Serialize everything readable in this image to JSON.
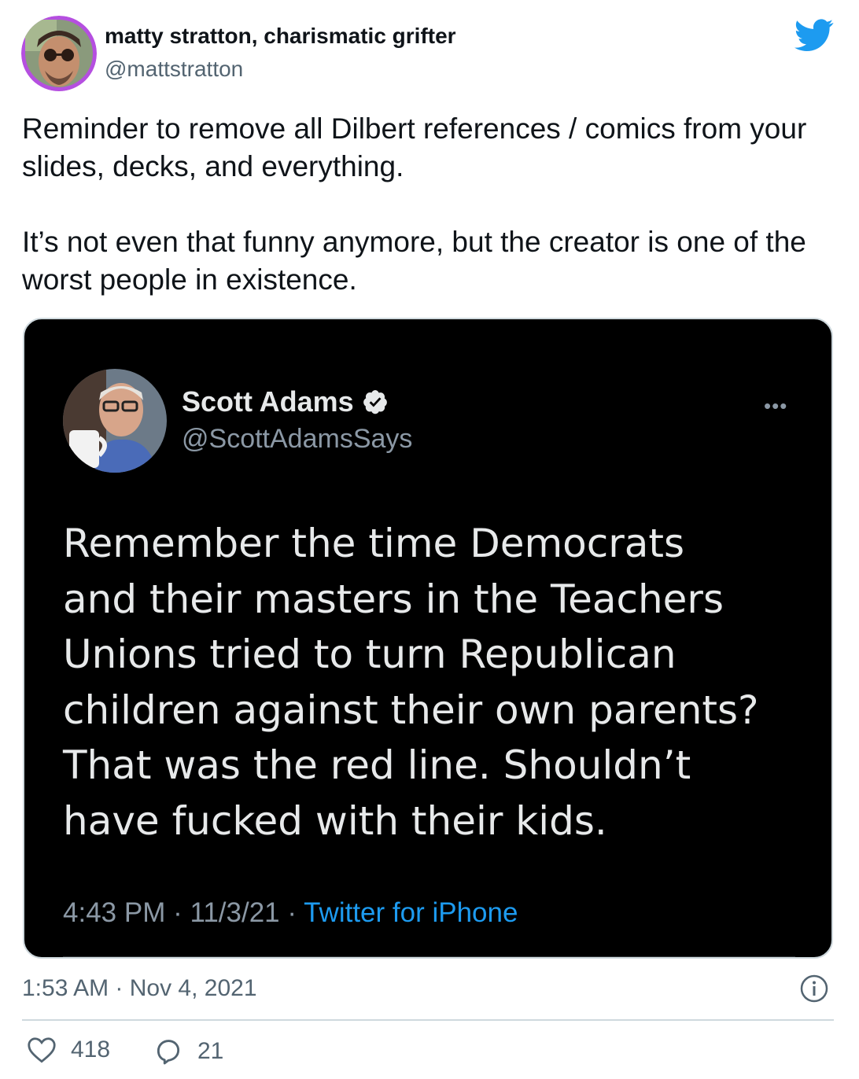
{
  "author": {
    "display_name": "matty stratton, charismatic grifter",
    "handle": "@mattstratton"
  },
  "tweet": {
    "paragraphs": [
      "Reminder to remove all Dilbert references / comics from your slides, decks, and everything.",
      "It’s not even that funny anymore, but the creator is one of the worst people in existence."
    ],
    "timestamp": "1:53 AM · Nov 4, 2021",
    "likes": "418",
    "replies": "21"
  },
  "quoted": {
    "display_name": "Scott Adams",
    "handle": "@ScottAdamsSays",
    "text": "Remember the time Democrats and their masters in the Teachers Unions tried to turn Republican children against their own parents? That was the red line. Shouldn’t have fucked with their kids.",
    "time": "4:43 PM · 11/3/21 · ",
    "source": "Twitter for iPhone",
    "more": "•••"
  },
  "icons": [
    "twitter-bird-icon",
    "verified-badge-icon",
    "more-icon",
    "info-icon",
    "heart-icon",
    "reply-icon"
  ],
  "colors": {
    "twitter_blue": "#1d9bf0",
    "avatar_ring": "#a64bd6"
  }
}
